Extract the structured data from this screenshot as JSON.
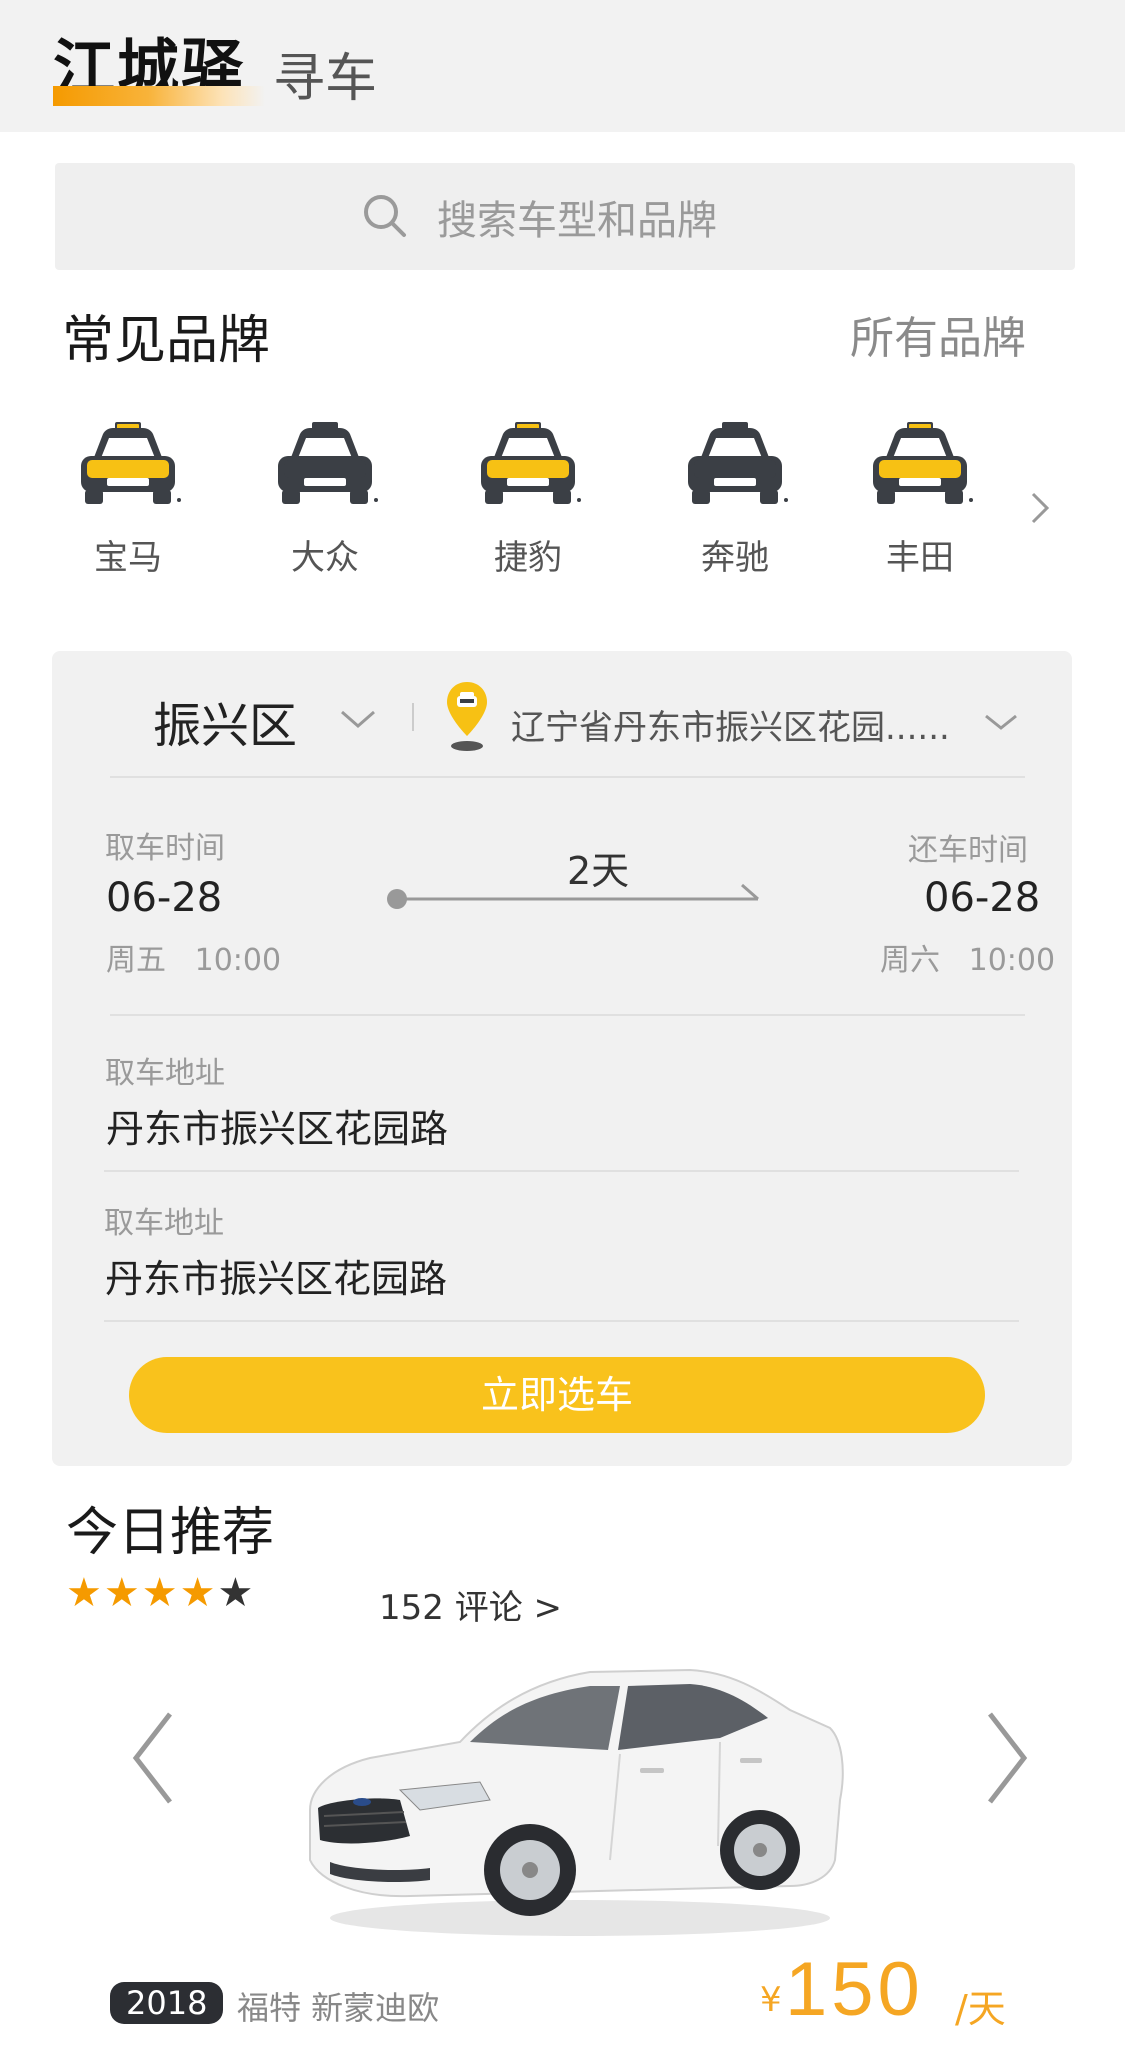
{
  "header": {
    "logo_text": "江城驿",
    "page_title": "寻车"
  },
  "search": {
    "placeholder": "搜索车型和品牌",
    "icon": "search-icon"
  },
  "brands": {
    "title": "常见品牌",
    "all_label": "所有品牌",
    "items": [
      {
        "label": "宝马",
        "color": "#f7c114"
      },
      {
        "label": "大众",
        "color": "#3b3f45"
      },
      {
        "label": "捷豹",
        "color": "#f7c114"
      },
      {
        "label": "奔驰",
        "color": "#3b3f45"
      },
      {
        "label": "丰田",
        "color": "#f7c114"
      }
    ]
  },
  "booking": {
    "district": "振兴区",
    "address": "辽宁省丹东市振兴区花园......",
    "pickup": {
      "label": "取车时间",
      "date": "06-28",
      "weekday": "周五",
      "time": "10:00"
    },
    "return": {
      "label": "还车时间",
      "date": "06-28",
      "weekday": "周六",
      "time": "10:00"
    },
    "duration": "2天",
    "pickup_address": {
      "label": "取车地址",
      "value": "丹东市振兴区花园路"
    },
    "return_address": {
      "label": "取车地址",
      "value": "丹东市振兴区花园路"
    },
    "cta_label": "立即选车"
  },
  "recommend": {
    "title": "今日推荐",
    "rating": 4,
    "rating_max": 5,
    "reviews": "152 评论 >",
    "year": "2018",
    "model": "福特 新蒙迪欧",
    "currency": "¥",
    "price": "150",
    "unit": "/天"
  },
  "colors": {
    "accent": "#f9c21c",
    "price": "#f5a623",
    "star": "#f59a00"
  }
}
